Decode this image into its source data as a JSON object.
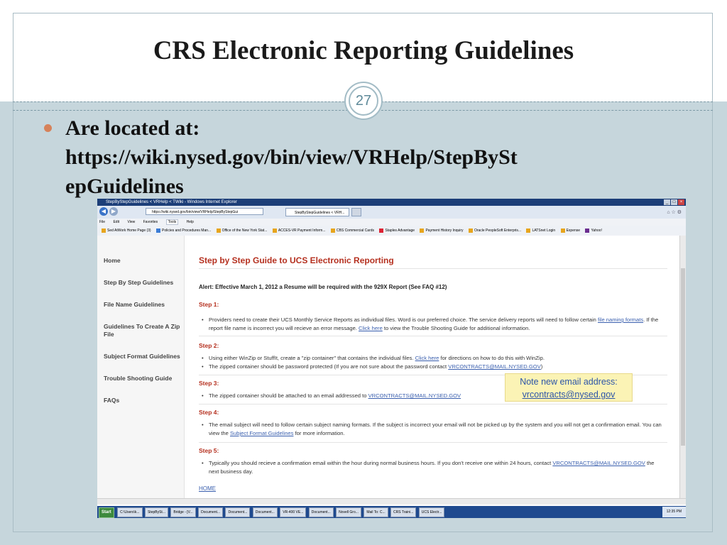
{
  "slide": {
    "title": "CRS Electronic Reporting Guidelines",
    "page_number": "27",
    "bullet_lines": [
      "Are located at:",
      "https://wiki.nysed.gov/bin/view/VRHelp/StepBySt",
      "epGuidelines"
    ],
    "accent_color": "#d6825a"
  },
  "browser": {
    "window_title": "StepByStepGuidelines < VRHelp < TWiki - Windows Internet Explorer",
    "address": "https://wiki.nysed.gov/bin/view/VRHelp/StepByStepGui",
    "tab_title": "StepByStepGuidelines < VRH...",
    "menu": [
      "File",
      "Edit",
      "View",
      "Favorites",
      "Tools",
      "Help"
    ],
    "favorites": [
      "Sed AtWork Home Page (3)",
      "Policies and Procedures Man...",
      "Office of the New York Stat...",
      "ACCES-VR Payment Inform...",
      "CBS Commercial Cards",
      "Staples Advantage",
      "Payment History Inquiry",
      "Oracle PeopleSoft Enterpris...",
      "LATSnet Login",
      "Expense",
      "Yahoo!"
    ]
  },
  "sidebar": {
    "items": [
      "Home",
      "Step By Step Guidelines",
      "File Name Guidelines",
      "Guidelines To Create A Zip File",
      "Subject Format Guidelines",
      "Trouble Shooting Guide",
      "FAQs"
    ]
  },
  "page": {
    "heading": "Step by Step Guide to UCS Electronic Reporting",
    "alert": "Alert: Effective March 1, 2012 a Resume will be required with the 929X Report (See FAQ #12)",
    "step1": {
      "label": "Step 1:",
      "t1": "Providers need to create their UCS Monthly Service Reports as individual files. Word is our preferred choice. The service delivery reports will need to follow certain ",
      "l1": "file naming formats",
      "t2": ". If the report file name is incorrect you will recieve an error message. ",
      "l2": "Click here",
      "t3": " to view the Trouble Shooting Guide for additional information."
    },
    "step2": {
      "label": "Step 2:",
      "b1_t1": "Using either WinZip or StuffIt, create a \"zip container\" that contains the individual files. ",
      "b1_l1": "Click here",
      "b1_t2": " for directions on how to do this with WinZip.",
      "b2_t1": "The zipped container should be password protected (If you are not sure about the password contact ",
      "b2_l1": "VRCONTRACTS@MAIL.NYSED.GOV",
      "b2_t2": ")"
    },
    "step3": {
      "label": "Step 3:",
      "t1": "The zipped container should be attached to an email addressed to ",
      "l1": "VRCONTRACTS@MAIL.NYSED.GOV"
    },
    "step4": {
      "label": "Step 4:",
      "t1": "The email subject will need to follow certain subject naming formats. If the subject is incorrect your email will not be picked up by the system and you will not get a confirmation email. You can view the ",
      "l1": "Subject Format Guidelines",
      "t2": " for more information."
    },
    "step5": {
      "label": "Step 5:",
      "t1": "Typically you should recieve a confirmation email within the hour during normal business hours. If you don't receive one within 24 hours, contact ",
      "l1": "VRCONTRACTS@MAIL.NYSED.GOV",
      "t2": " the next business day."
    },
    "home_link": "HOME"
  },
  "taskbar": {
    "start": "Start",
    "tasks": [
      "C:\\Users\\k...",
      "StepBySt...",
      "Bridge - [V...",
      "Document...",
      "Document...",
      "Document...",
      "VR-400 VE...",
      "Document...",
      "Novell Gro...",
      "Mail To: C...",
      "CRS Traini...",
      "UCS Electr..."
    ],
    "clock": "12:35 PM"
  },
  "note": {
    "line1": "Note new email address:",
    "line2": "vrcontracts@nysed.gov"
  }
}
